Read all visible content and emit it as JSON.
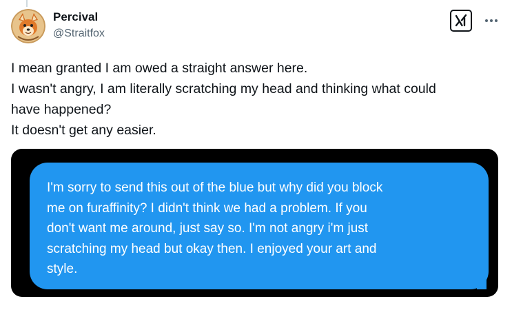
{
  "author": {
    "display_name": "Percival",
    "handle": "@Straitfox",
    "avatar_icon": "fox-avatar-icon"
  },
  "actions": {
    "grok_icon": "grok-icon",
    "more_icon": "more-dots-icon"
  },
  "post": {
    "lines": [
      "I mean granted I am owed a straight answer here.",
      "I wasn't angry, I am literally scratching my head and thinking what could",
      "have happened?",
      "It doesn't get any easier."
    ]
  },
  "media": {
    "bubble_color": "#2196f0",
    "bubble_lines": [
      "I'm sorry to send this out of the blue but why did you block",
      "me on furaffinity?  I didn't think we had a problem.  If you",
      "don't want me around, just say so.  I'm not angry i'm just",
      "scratching my head but okay then.  I enjoyed your art and",
      "style."
    ]
  }
}
